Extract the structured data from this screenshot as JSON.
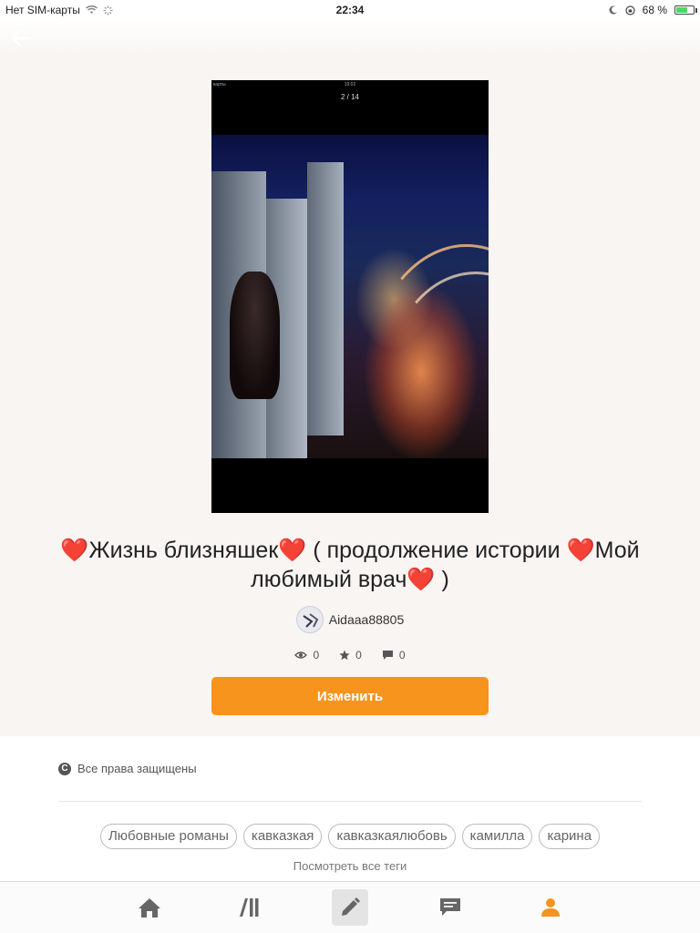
{
  "status_bar": {
    "carrier": "Нет SIM-карты",
    "time": "22:34",
    "battery": "68 %",
    "battery_level": 0.68
  },
  "cover": {
    "inner_status": "карты",
    "inner_time": "19:02",
    "page_indicator": "2 / 14"
  },
  "story": {
    "title": "❤️Жизнь близняшек❤️ ( продолжение истории ❤️Мой любимый врач❤️ )",
    "author": "Aidaaa88805",
    "views": "0",
    "votes": "0",
    "comments": "0"
  },
  "actions": {
    "edit_label": "Изменить"
  },
  "footer": {
    "copyright": "Все права защищены",
    "tags": [
      "Любовные романы",
      "кавказкая",
      "кавказкаялюбовь",
      "камилла",
      "карина"
    ],
    "all_tags_label": "Посмотреть все теги"
  },
  "tabbar": {
    "active_color": "#f7941e",
    "icons": [
      "home-icon",
      "library-icon",
      "write-icon",
      "messages-icon",
      "profile-icon"
    ]
  },
  "colors": {
    "accent": "#f7941e"
  }
}
